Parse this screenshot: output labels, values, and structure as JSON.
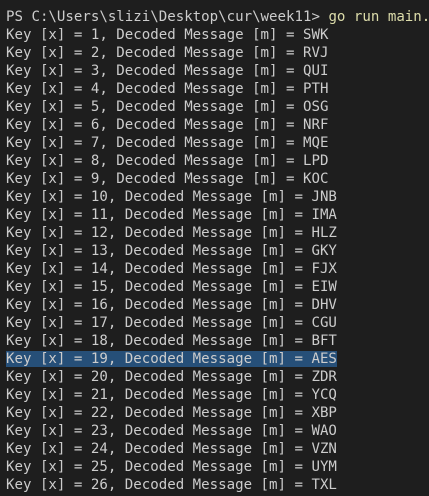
{
  "terminal": {
    "prompt": "PS C:\\Users\\slizi\\Desktop\\cur\\week11> ",
    "command": "go run main.go",
    "output_lines": [
      "Key [x] = 1, Decoded Message [m] = SWK",
      "Key [x] = 2, Decoded Message [m] = RVJ",
      "Key [x] = 3, Decoded Message [m] = QUI",
      "Key [x] = 4, Decoded Message [m] = PTH",
      "Key [x] = 5, Decoded Message [m] = OSG",
      "Key [x] = 6, Decoded Message [m] = NRF",
      "Key [x] = 7, Decoded Message [m] = MQE",
      "Key [x] = 8, Decoded Message [m] = LPD",
      "Key [x] = 9, Decoded Message [m] = KOC",
      "Key [x] = 10, Decoded Message [m] = JNB",
      "Key [x] = 11, Decoded Message [m] = IMA",
      "Key [x] = 12, Decoded Message [m] = HLZ",
      "Key [x] = 13, Decoded Message [m] = GKY",
      "Key [x] = 14, Decoded Message [m] = FJX",
      "Key [x] = 15, Decoded Message [m] = EIW",
      "Key [x] = 16, Decoded Message [m] = DHV",
      "Key [x] = 17, Decoded Message [m] = CGU",
      "Key [x] = 18, Decoded Message [m] = BFT",
      "Key [x] = 19, Decoded Message [m] = AES",
      "Key [x] = 20, Decoded Message [m] = ZDR",
      "Key [x] = 21, Decoded Message [m] = YCQ",
      "Key [x] = 22, Decoded Message [m] = XBP",
      "Key [x] = 23, Decoded Message [m] = WAO",
      "Key [x] = 24, Decoded Message [m] = VZN",
      "Key [x] = 25, Decoded Message [m] = UYM",
      "Key [x] = 26, Decoded Message [m] = TXL"
    ],
    "selected_line": "Key [x] = 19, Decoded Message [m] = AES",
    "colors": {
      "background": "#1e1e1e",
      "text": "#cccccc",
      "command": "#dcdcaa",
      "selection": "#264f78"
    }
  }
}
